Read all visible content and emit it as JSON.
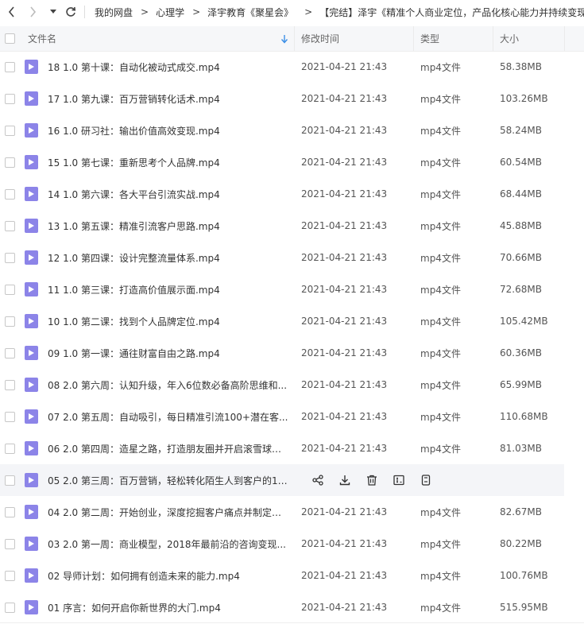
{
  "toolbar": {
    "back_icon": "chevron-left-icon",
    "forward_icon": "chevron-right-icon",
    "dropdown_icon": "caret-down-icon",
    "refresh_icon": "refresh-icon",
    "breadcrumb": [
      "我的网盘",
      "心理学",
      "泽宇教育《聚星会》",
      "【完结】泽宇《精准个人商业定位，产品化核心能力并持续变现》"
    ]
  },
  "table": {
    "columns": {
      "name": "文件名",
      "modified": "修改时间",
      "type": "类型",
      "size": "大小"
    },
    "sort_icon": "sort-down-arrow-icon",
    "rows": [
      {
        "name": "18 1.0 第十课：自动化被动式成交.mp4",
        "modified": "2021-04-21 21:43",
        "type": "mp4文件",
        "size": "58.38MB"
      },
      {
        "name": "17 1.0 第九课：百万营销转化话术.mp4",
        "modified": "2021-04-21 21:43",
        "type": "mp4文件",
        "size": "103.26MB"
      },
      {
        "name": "16 1.0 研习社：输出价值高效变现.mp4",
        "modified": "2021-04-21 21:43",
        "type": "mp4文件",
        "size": "58.24MB"
      },
      {
        "name": "15 1.0 第七课：重新思考个人品牌.mp4",
        "modified": "2021-04-21 21:43",
        "type": "mp4文件",
        "size": "60.54MB"
      },
      {
        "name": "14 1.0 第六课：各大平台引流实战.mp4",
        "modified": "2021-04-21 21:43",
        "type": "mp4文件",
        "size": "68.44MB"
      },
      {
        "name": "13 1.0 第五课：精准引流客户思路.mp4",
        "modified": "2021-04-21 21:43",
        "type": "mp4文件",
        "size": "45.88MB"
      },
      {
        "name": "12 1.0 第四课：设计完整流量体系.mp4",
        "modified": "2021-04-21 21:43",
        "type": "mp4文件",
        "size": "70.66MB"
      },
      {
        "name": "11 1.0 第三课：打造高价值展示面.mp4",
        "modified": "2021-04-21 21:43",
        "type": "mp4文件",
        "size": "72.68MB"
      },
      {
        "name": "10 1.0 第二课：找到个人品牌定位.mp4",
        "modified": "2021-04-21 21:43",
        "type": "mp4文件",
        "size": "105.42MB"
      },
      {
        "name": "09 1.0 第一课：通往财富自由之路.mp4",
        "modified": "2021-04-21 21:43",
        "type": "mp4文件",
        "size": "60.36MB"
      },
      {
        "name": "08 2.0 第六周：认知升级，年入6位数必备高阶思维和...",
        "modified": "2021-04-21 21:43",
        "type": "mp4文件",
        "size": "65.99MB"
      },
      {
        "name": "07 2.0 第五周：自动吸引，每日精准引流100+潜在客...",
        "modified": "2021-04-21 21:43",
        "type": "mp4文件",
        "size": "110.68MB"
      },
      {
        "name": "06 2.0 第四周：造星之路，打造朋友圈并开启滚雪球模...",
        "modified": "2021-04-21 21:43",
        "type": "mp4文件",
        "size": "81.03MB"
      },
      {
        "name": "05 2.0 第三周：百万营销，轻松转化陌生人到客户的12...",
        "hover": true
      },
      {
        "name": "04 2.0 第二周：开始创业，深度挖掘客户痛点并制定服...",
        "modified": "2021-04-21 21:43",
        "type": "mp4文件",
        "size": "82.67MB"
      },
      {
        "name": "03 2.0 第一周：商业模型，2018年最前沿的咨询变现...",
        "modified": "2021-04-21 21:43",
        "type": "mp4文件",
        "size": "80.22MB"
      },
      {
        "name": "02 导师计划：如何拥有创造未来的能力.mp4",
        "modified": "2021-04-21 21:43",
        "type": "mp4文件",
        "size": "100.76MB"
      },
      {
        "name": "01 序言：如何开启你新世界的大门.mp4",
        "modified": "2021-04-21 21:43",
        "type": "mp4文件",
        "size": "515.95MB"
      }
    ],
    "hover_actions": [
      "share-icon",
      "download-icon",
      "delete-icon",
      "rename-icon",
      "more-icon"
    ]
  },
  "colors": {
    "file_icon": "#8c84e8",
    "hover_row": "#f4f5f8",
    "header_bg": "#f6f7f9",
    "sort_arrow": "#3b8ee6"
  }
}
